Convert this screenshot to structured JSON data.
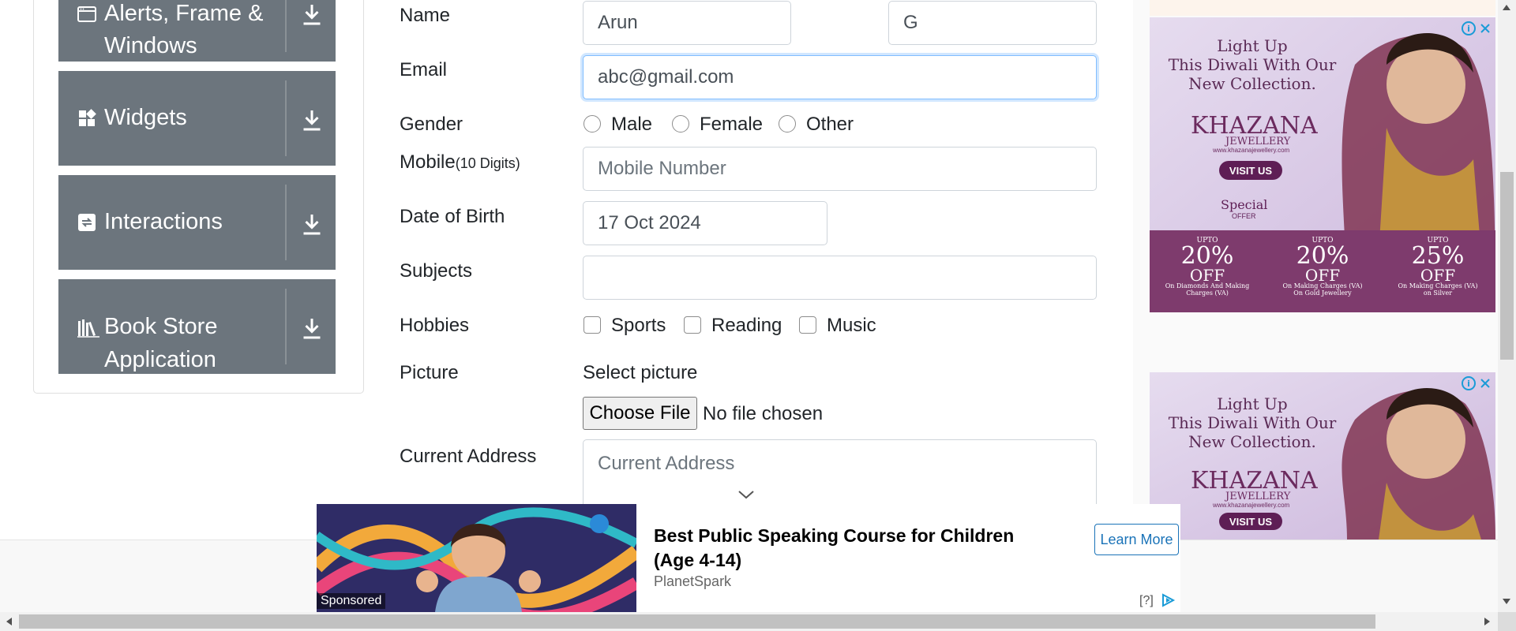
{
  "sidebar": {
    "groups": [
      {
        "label_line1": "Alerts, Frame &",
        "label_line2": "Windows",
        "icon": "window-icon"
      },
      {
        "label_line1": "Widgets",
        "icon": "widgets-icon"
      },
      {
        "label_line1": "Interactions",
        "icon": "interactions-icon"
      },
      {
        "label_line1": "Book Store",
        "label_line2": "Application",
        "icon": "books-icon"
      }
    ]
  },
  "form": {
    "name_label": "Name",
    "first_name": "Arun",
    "last_name": "G",
    "email_label": "Email",
    "email_value": "abc@gmail.com",
    "gender_label": "Gender",
    "gender_options": [
      "Male",
      "Female",
      "Other"
    ],
    "mobile_label": "Mobile",
    "mobile_hint": "(10 Digits)",
    "mobile_placeholder": "Mobile Number",
    "dob_label": "Date of Birth",
    "dob_value": "17 Oct 2024",
    "subjects_label": "Subjects",
    "subjects_value": "",
    "hobbies_label": "Hobbies",
    "hobby_options": [
      "Sports",
      "Reading",
      "Music"
    ],
    "picture_label": "Picture",
    "picture_hint": "Select picture",
    "choose_file_label": "Choose File",
    "no_file_text": "No file chosen",
    "address_label": "Current Address",
    "address_placeholder": "Current Address"
  },
  "ads": {
    "right_ad": {
      "line1": "Light Up",
      "line2": "This Diwali With Our",
      "line3": "New Collection.",
      "brand": "KHAZANA",
      "brand_sub": "JEWELLERY",
      "site": "www.khazanajewellery.com",
      "cta": "VISIT US",
      "special": "Special",
      "special_sub": "OFFER",
      "offers": [
        {
          "upto": "UPTO",
          "pct": "20%",
          "off": "OFF",
          "desc": "On Diamonds And Making Charges (VA)"
        },
        {
          "upto": "UPTO",
          "pct": "20%",
          "off": "OFF",
          "desc": "On Making Charges (VA) On Gold Jewellery"
        },
        {
          "upto": "UPTO",
          "pct": "25%",
          "off": "OFF",
          "desc": "On Making Charges (VA) on Silver"
        }
      ]
    },
    "bottom_ad": {
      "title": "Best Public Speaking Course for Children (Age 4-14)",
      "brand": "PlanetSpark",
      "cta": "Learn More",
      "sponsored": "Sponsored",
      "help": "[?]"
    }
  },
  "colors": {
    "sidebar_group_bg": "#6c757d",
    "input_border": "#ced4da",
    "focus_border": "#80bdff",
    "ad_bg": "#d9c6e3",
    "offer_bg": "#7e3b6d",
    "learn_more": "#1a73b8"
  }
}
